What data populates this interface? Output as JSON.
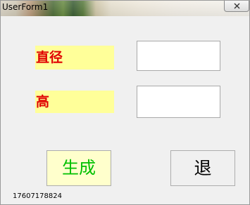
{
  "window": {
    "title": "UserForm1"
  },
  "form": {
    "diameter_label": "直径",
    "height_label": "高",
    "diameter_value": "",
    "height_value": ""
  },
  "buttons": {
    "generate_label": "生成",
    "exit_label": "退"
  },
  "footer": {
    "text": "17607178824"
  },
  "icons": {
    "close": "close-icon"
  },
  "colors": {
    "label_background": "#ffff99",
    "label_text": "#e00000",
    "generate_background": "#ffffcc",
    "generate_text": "#00c000"
  }
}
